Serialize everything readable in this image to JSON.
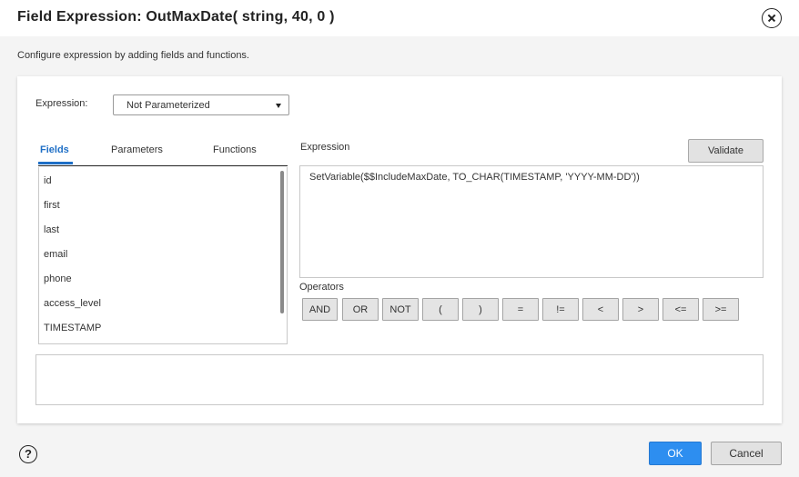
{
  "dialog": {
    "title": "Field Expression: OutMaxDate( string, 40, 0 )",
    "subtitle": "Configure expression by adding fields and functions.",
    "close_icon": "close-circle-icon"
  },
  "expression_select": {
    "label": "Expression:",
    "value": "Not Parameterized"
  },
  "tabs": [
    "Fields",
    "Parameters",
    "Functions"
  ],
  "active_tab": "Fields",
  "fields": [
    "id",
    "first",
    "last",
    "email",
    "phone",
    "access_level",
    "TIMESTAMP"
  ],
  "editor": {
    "label": "Expression",
    "validate_label": "Validate",
    "text": "SetVariable($$IncludeMaxDate, TO_CHAR(TIMESTAMP, 'YYYY-MM-DD'))"
  },
  "operators": {
    "label": "Operators",
    "items": [
      "AND",
      "OR",
      "NOT",
      "(",
      ")",
      "=",
      "!=",
      "<",
      ">",
      "<=",
      ">="
    ]
  },
  "footer": {
    "help_icon": "help-circle-icon",
    "help_glyph": "?",
    "ok_label": "OK",
    "cancel_label": "Cancel"
  },
  "colors": {
    "accent": "#1f6fc6",
    "primary_button": "#2d8ef0",
    "background": "#f4f4f4"
  }
}
